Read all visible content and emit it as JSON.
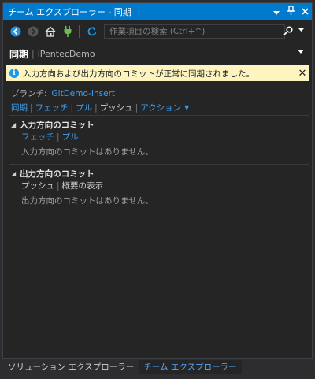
{
  "window": {
    "title": "チーム エクスプローラー - 同期",
    "dropdown_icon": "chevron-down-icon",
    "pin_icon": "pin-icon",
    "close_icon": "close-icon"
  },
  "toolbar": {
    "search_placeholder": "作業項目の検索 (Ctrl+^)",
    "icons": [
      "back-icon",
      "forward-icon",
      "home-icon",
      "connect-icon",
      "refresh-icon",
      "search-icon"
    ]
  },
  "header": {
    "title": "同期",
    "divider": "|",
    "repo": "iPentecDemo"
  },
  "info": {
    "message": "入力方向および出力方向のコミットが正常に同期されました。"
  },
  "branch": {
    "label": "ブランチ:",
    "value": "GitDemo-Insert"
  },
  "actions": {
    "sync": "同期",
    "fetch": "フェッチ",
    "pull": "プル",
    "push": "プッシュ",
    "actions": "アクション"
  },
  "incoming": {
    "title": "入力方向のコミット",
    "fetch": "フェッチ",
    "pull": "プル",
    "empty": "入力方向のコミットはありません。"
  },
  "outgoing": {
    "title": "出力方向のコミット",
    "push": "プッシュ",
    "summary": "概要の表示",
    "empty": "出力方向のコミットはありません。"
  },
  "tabs": [
    {
      "label": "ソリューション エクスプローラー",
      "active": false
    },
    {
      "label": "チーム エクスプローラー",
      "active": true
    }
  ],
  "colors": {
    "accent": "#007acc",
    "link": "#3ca0f0",
    "info_bg": "#fdf4bf",
    "background": "#252526"
  }
}
